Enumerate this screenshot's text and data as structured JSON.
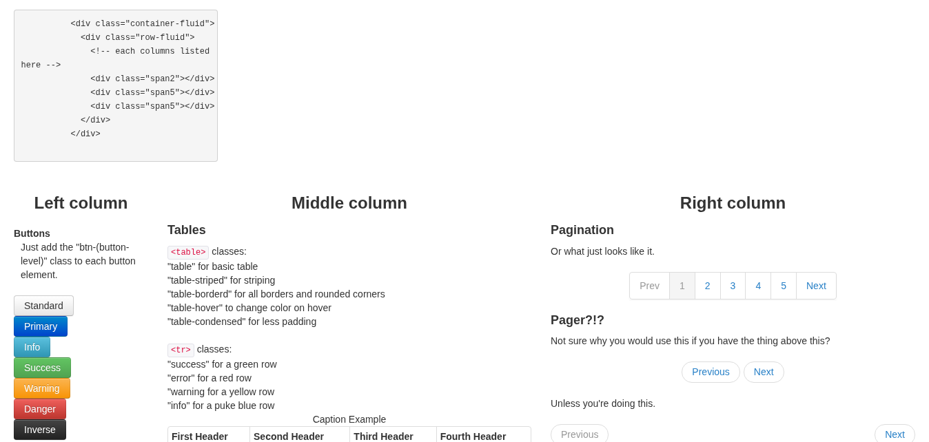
{
  "code_block": {
    "lines": [
      "          <div class=\"container-fluid\">",
      "            <div class=\"row-fluid\">",
      "              <!-- each columns listed",
      "here -->",
      "              <div class=\"span2\"></div>",
      "              <div class=\"span5\"></div>",
      "              <div class=\"span5\"></div>",
      "            </div>",
      "          </div>"
    ]
  },
  "left_column": {
    "heading": "Left column",
    "section_title": "Buttons",
    "description": "Just add the \"btn-(button-level)\" class to each button element.",
    "buttons": [
      {
        "label": "Standard",
        "kind": "default"
      },
      {
        "label": "Primary",
        "kind": "primary"
      },
      {
        "label": "Info",
        "kind": "info"
      },
      {
        "label": "Success",
        "kind": "success"
      },
      {
        "label": "Warning",
        "kind": "warning"
      },
      {
        "label": "Danger",
        "kind": "danger"
      },
      {
        "label": "Inverse",
        "kind": "inverse"
      }
    ]
  },
  "middle_column": {
    "heading": "Middle column",
    "section_title": "Tables",
    "class_groups": [
      {
        "tag": "<table>",
        "label": "classes:",
        "lines": [
          "\"table\" for basic table",
          "\"table-striped\" for striping",
          "\"table-borderd\" for all borders and rounded corners",
          "\"table-hover\" to change color on hover",
          "\"table-condensed\" for less padding"
        ]
      },
      {
        "tag": "<tr>",
        "label": "classes:",
        "lines": [
          "\"success\" for a green row",
          "\"error\" for a red row",
          "\"warning for a yellow row",
          "\"info\" for a puke blue row"
        ]
      }
    ],
    "table": {
      "caption": "Caption Example",
      "columns": [
        "First Header",
        "Second Header",
        "Third Header",
        "Fourth Header"
      ]
    }
  },
  "right_column": {
    "heading": "Right column",
    "pagination": {
      "title": "Pagination",
      "description": "Or what just looks like it.",
      "prev": {
        "label": "Prev",
        "disabled": true
      },
      "pages": [
        {
          "label": "1",
          "selected": true
        },
        {
          "label": "2",
          "selected": false
        },
        {
          "label": "3",
          "selected": false
        },
        {
          "label": "4",
          "selected": false
        },
        {
          "label": "5",
          "selected": false
        }
      ],
      "next": {
        "label": "Next",
        "disabled": false
      }
    },
    "pager": {
      "title": "Pager?!?",
      "description": "Not sure why you would use this if you have the thing above this?",
      "buttons": [
        {
          "label": "Previous",
          "disabled": false
        },
        {
          "label": "Next",
          "disabled": false
        }
      ]
    },
    "aligned_pager": {
      "description": "Unless you're doing this.",
      "previous": {
        "label": "Previous",
        "disabled": true
      },
      "next": {
        "label": "Next",
        "disabled": false
      }
    }
  }
}
